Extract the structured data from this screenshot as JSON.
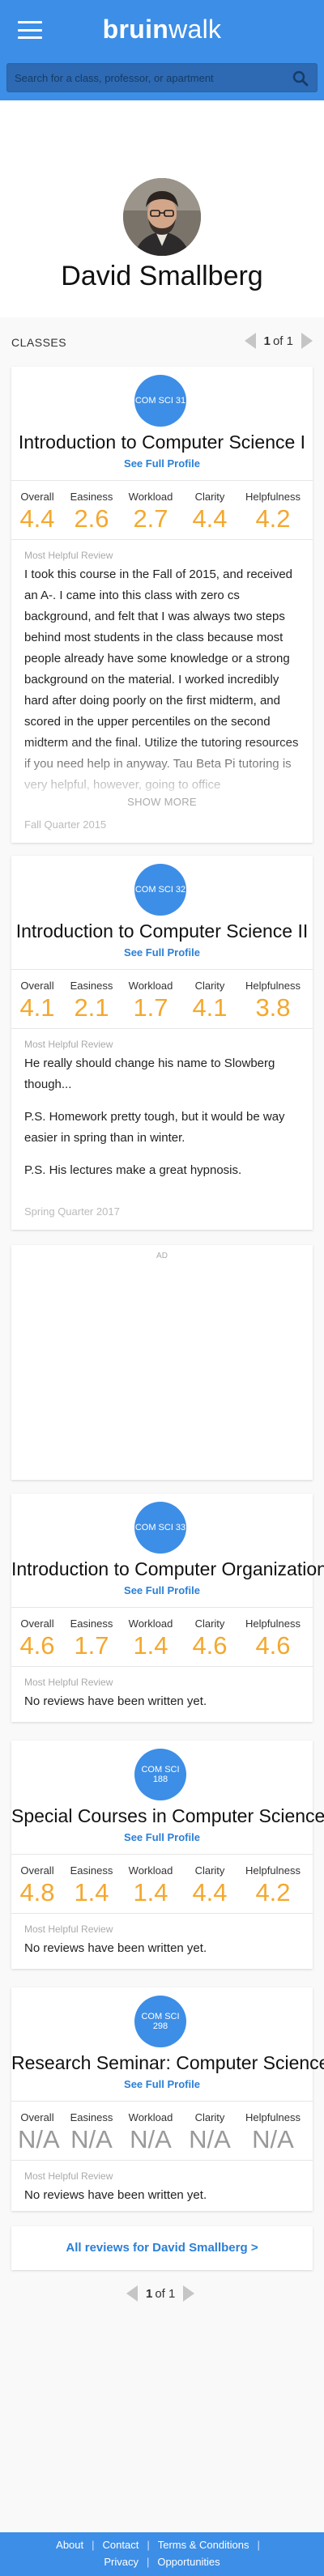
{
  "header": {
    "logo_bold": "bruin",
    "logo_light": "walk",
    "search_placeholder": "Search for a class, professor, or apartment"
  },
  "professor": {
    "name": "David Smallberg"
  },
  "classes_section": {
    "label": "CLASSES",
    "page_current": "1",
    "page_suffix": "of 1"
  },
  "rating_labels": [
    "Overall",
    "Easiness",
    "Workload",
    "Clarity",
    "Helpfulness"
  ],
  "most_helpful_label": "Most Helpful Review",
  "see_full_profile": "See Full Profile",
  "courses": [
    {
      "code": "COM SCI 31",
      "title": "Introduction to Computer Science I",
      "ratings": [
        "4.4",
        "2.6",
        "2.7",
        "4.4",
        "4.2"
      ],
      "review": [
        "I took this course in the Fall of 2015, and received an A-. I came into this class with zero cs background, and felt that I was always two steps behind most students in the class because most people already have some knowledge or a strong background on the material. I worked incredibly hard after doing poorly on the first midterm, and scored in the upper percentiles on the second midterm and the final. Utilize the tutoring resources if you need help in anyway. Tau Beta Pi tutoring is very helpful, however, going to office"
      ],
      "show_more": "SHOW MORE",
      "quarter": "Fall Quarter 2015"
    },
    {
      "code": "COM SCI 32",
      "title": "Introduction to Computer Science II",
      "ratings": [
        "4.1",
        "2.1",
        "1.7",
        "4.1",
        "3.8"
      ],
      "review": [
        "He really should change his name to Slowberg though...",
        "P.S. Homework pretty tough, but it would be way easier in spring than in winter.",
        "P.S. His lectures make a great hypnosis."
      ],
      "quarter": "Spring Quarter 2017"
    },
    {
      "code": "COM SCI 33",
      "title": "Introduction to Computer Organization",
      "ratings": [
        "4.6",
        "1.7",
        "1.4",
        "4.6",
        "4.6"
      ],
      "review": [
        "No reviews have been written yet."
      ]
    },
    {
      "code": "COM SCI 188",
      "title": "Special Courses in Computer Science",
      "ratings": [
        "4.8",
        "1.4",
        "1.4",
        "4.4",
        "4.2"
      ],
      "review": [
        "No reviews have been written yet."
      ]
    },
    {
      "code": "COM SCI 298",
      "title": "Research Seminar: Computer Science",
      "ratings": [
        "N/A",
        "N/A",
        "N/A",
        "N/A",
        "N/A"
      ],
      "review": [
        "No reviews have been written yet."
      ]
    }
  ],
  "ad": {
    "label": "AD"
  },
  "all_reviews_link": "All reviews for David Smallberg >",
  "bottom_pager": {
    "page_current": "1",
    "page_suffix": "of 1"
  },
  "footer": {
    "links_row1": [
      "About",
      "Contact",
      "Terms & Conditions"
    ],
    "links_row2": [
      "Privacy",
      "Opportunities"
    ]
  },
  "colors": {
    "brand_blue": "#3d8ee6",
    "rating_orange": "#f4a82e",
    "link_blue": "#2a7fd6"
  }
}
